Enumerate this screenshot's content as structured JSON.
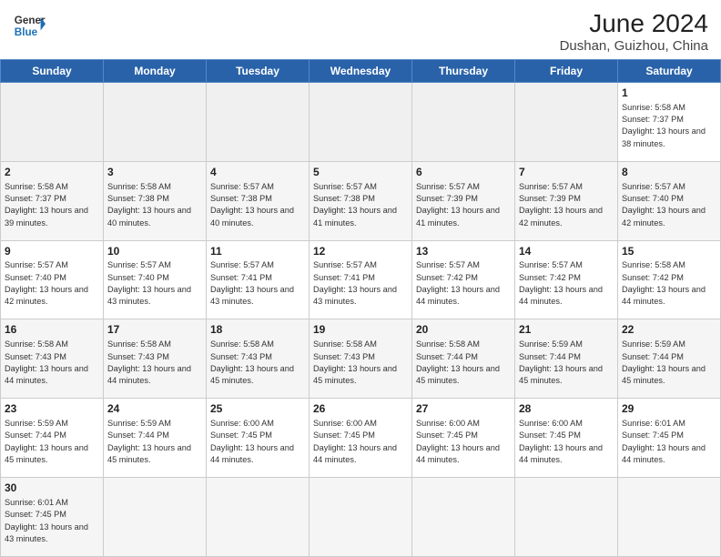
{
  "header": {
    "logo_line1": "General",
    "logo_line2": "Blue",
    "title": "June 2024",
    "subtitle": "Dushan, Guizhou, China"
  },
  "weekdays": [
    "Sunday",
    "Monday",
    "Tuesday",
    "Wednesday",
    "Thursday",
    "Friday",
    "Saturday"
  ],
  "weeks": [
    [
      {
        "day": "",
        "info": ""
      },
      {
        "day": "",
        "info": ""
      },
      {
        "day": "",
        "info": ""
      },
      {
        "day": "",
        "info": ""
      },
      {
        "day": "",
        "info": ""
      },
      {
        "day": "",
        "info": ""
      },
      {
        "day": "1",
        "info": "Sunrise: 5:58 AM\nSunset: 7:37 PM\nDaylight: 13 hours and 38 minutes."
      }
    ],
    [
      {
        "day": "2",
        "info": "Sunrise: 5:58 AM\nSunset: 7:37 PM\nDaylight: 13 hours and 39 minutes."
      },
      {
        "day": "3",
        "info": "Sunrise: 5:58 AM\nSunset: 7:38 PM\nDaylight: 13 hours and 40 minutes."
      },
      {
        "day": "4",
        "info": "Sunrise: 5:57 AM\nSunset: 7:38 PM\nDaylight: 13 hours and 40 minutes."
      },
      {
        "day": "5",
        "info": "Sunrise: 5:57 AM\nSunset: 7:38 PM\nDaylight: 13 hours and 41 minutes."
      },
      {
        "day": "6",
        "info": "Sunrise: 5:57 AM\nSunset: 7:39 PM\nDaylight: 13 hours and 41 minutes."
      },
      {
        "day": "7",
        "info": "Sunrise: 5:57 AM\nSunset: 7:39 PM\nDaylight: 13 hours and 42 minutes."
      },
      {
        "day": "8",
        "info": "Sunrise: 5:57 AM\nSunset: 7:40 PM\nDaylight: 13 hours and 42 minutes."
      }
    ],
    [
      {
        "day": "9",
        "info": "Sunrise: 5:57 AM\nSunset: 7:40 PM\nDaylight: 13 hours and 42 minutes."
      },
      {
        "day": "10",
        "info": "Sunrise: 5:57 AM\nSunset: 7:40 PM\nDaylight: 13 hours and 43 minutes."
      },
      {
        "day": "11",
        "info": "Sunrise: 5:57 AM\nSunset: 7:41 PM\nDaylight: 13 hours and 43 minutes."
      },
      {
        "day": "12",
        "info": "Sunrise: 5:57 AM\nSunset: 7:41 PM\nDaylight: 13 hours and 43 minutes."
      },
      {
        "day": "13",
        "info": "Sunrise: 5:57 AM\nSunset: 7:42 PM\nDaylight: 13 hours and 44 minutes."
      },
      {
        "day": "14",
        "info": "Sunrise: 5:57 AM\nSunset: 7:42 PM\nDaylight: 13 hours and 44 minutes."
      },
      {
        "day": "15",
        "info": "Sunrise: 5:58 AM\nSunset: 7:42 PM\nDaylight: 13 hours and 44 minutes."
      }
    ],
    [
      {
        "day": "16",
        "info": "Sunrise: 5:58 AM\nSunset: 7:43 PM\nDaylight: 13 hours and 44 minutes."
      },
      {
        "day": "17",
        "info": "Sunrise: 5:58 AM\nSunset: 7:43 PM\nDaylight: 13 hours and 44 minutes."
      },
      {
        "day": "18",
        "info": "Sunrise: 5:58 AM\nSunset: 7:43 PM\nDaylight: 13 hours and 45 minutes."
      },
      {
        "day": "19",
        "info": "Sunrise: 5:58 AM\nSunset: 7:43 PM\nDaylight: 13 hours and 45 minutes."
      },
      {
        "day": "20",
        "info": "Sunrise: 5:58 AM\nSunset: 7:44 PM\nDaylight: 13 hours and 45 minutes."
      },
      {
        "day": "21",
        "info": "Sunrise: 5:59 AM\nSunset: 7:44 PM\nDaylight: 13 hours and 45 minutes."
      },
      {
        "day": "22",
        "info": "Sunrise: 5:59 AM\nSunset: 7:44 PM\nDaylight: 13 hours and 45 minutes."
      }
    ],
    [
      {
        "day": "23",
        "info": "Sunrise: 5:59 AM\nSunset: 7:44 PM\nDaylight: 13 hours and 45 minutes."
      },
      {
        "day": "24",
        "info": "Sunrise: 5:59 AM\nSunset: 7:44 PM\nDaylight: 13 hours and 45 minutes."
      },
      {
        "day": "25",
        "info": "Sunrise: 6:00 AM\nSunset: 7:45 PM\nDaylight: 13 hours and 44 minutes."
      },
      {
        "day": "26",
        "info": "Sunrise: 6:00 AM\nSunset: 7:45 PM\nDaylight: 13 hours and 44 minutes."
      },
      {
        "day": "27",
        "info": "Sunrise: 6:00 AM\nSunset: 7:45 PM\nDaylight: 13 hours and 44 minutes."
      },
      {
        "day": "28",
        "info": "Sunrise: 6:00 AM\nSunset: 7:45 PM\nDaylight: 13 hours and 44 minutes."
      },
      {
        "day": "29",
        "info": "Sunrise: 6:01 AM\nSunset: 7:45 PM\nDaylight: 13 hours and 44 minutes."
      }
    ],
    [
      {
        "day": "30",
        "info": "Sunrise: 6:01 AM\nSunset: 7:45 PM\nDaylight: 13 hours and 43 minutes."
      },
      {
        "day": "",
        "info": ""
      },
      {
        "day": "",
        "info": ""
      },
      {
        "day": "",
        "info": ""
      },
      {
        "day": "",
        "info": ""
      },
      {
        "day": "",
        "info": ""
      },
      {
        "day": "",
        "info": ""
      }
    ]
  ]
}
